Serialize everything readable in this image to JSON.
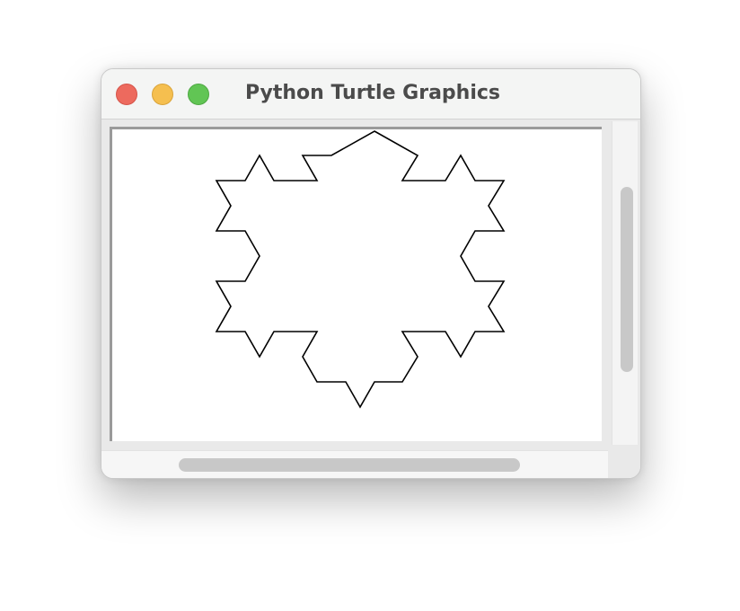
{
  "window": {
    "title": "Python Turtle Graphics"
  },
  "buttons": {
    "close": "close",
    "minimize": "minimize",
    "zoom": "zoom"
  },
  "canvas": {
    "drawing": "koch-snowflake",
    "stroke_color": "#000000",
    "background_color": "#ffffff"
  },
  "colors": {
    "close": "#ed6a5e",
    "minimize": "#f5bf4f",
    "zoom": "#61c554"
  }
}
